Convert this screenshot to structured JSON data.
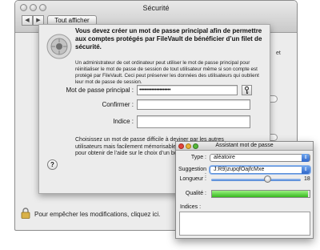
{
  "window": {
    "title": "Sécurité",
    "show_all_label": "Tout afficher",
    "back_glyph": "◀",
    "forward_glyph": "▶",
    "lock_icon": "lock-icon",
    "lock_text": "Pour empêcher les modifications, cliquez ici.",
    "side_fragment": "et"
  },
  "sheet": {
    "icon": "filevault-icon",
    "heading": "Vous devez créer un mot de passe principal afin de permettre aux comptes protégés par FileVault de bénéficier d’un filet de sécurité.",
    "body": "Un administrateur de cet ordinateur peut utiliser le mot de passe principal pour réinitialiser le mot de passe de session de tout utilisateur même si son compte est protégé par FileVault. Ceci peut préserver les données des utilisateurs qui oublient leur mot de passe de session.",
    "master_password_label": "Mot de passe principal :",
    "master_password_value": "••••••••••••••••••••",
    "confirm_label": "Confirmer :",
    "hint_label": "Indice :",
    "note": "Choisissez un mot de passe difficile à deviner par les autres utilisateurs mais facilement mémorisable pour vous. Cliquez sur la clé pour obtenir de l’aide sur le choix d’un bon mot de passe.",
    "help_label": "?"
  },
  "assistant": {
    "title": "Assistant mot de passe",
    "type_label": "Type :",
    "type_value": "aléatoire",
    "suggestion_label": "Suggestion :",
    "suggestion_value": "J:R9)zupqfOajfcMxe",
    "length_label": "Longueur :",
    "length_value": "18",
    "length_min": 8,
    "length_max": 24,
    "quality_label": "Qualité :",
    "quality_fraction": 0.98,
    "hints_label": "Indices :",
    "hints_value": ""
  },
  "colors": {
    "quality_green": "#36b81e",
    "popup_blue": "#2f66c9"
  }
}
